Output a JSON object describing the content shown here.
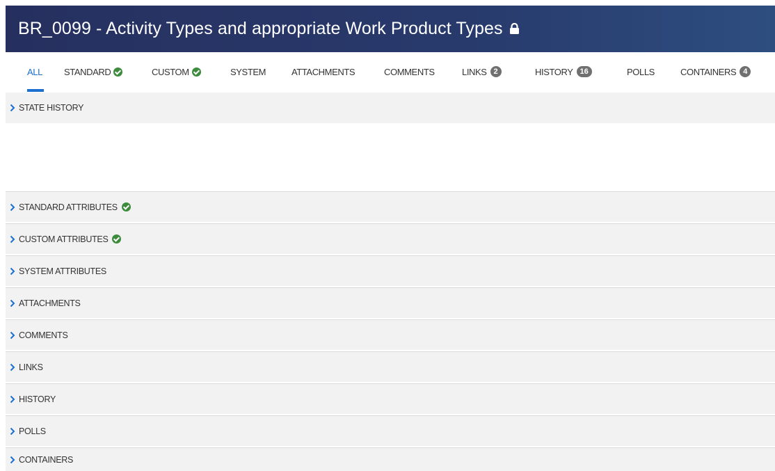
{
  "header": {
    "title": "BR_0099 - Activity Types and appropriate Work Product Types",
    "lock_icon": "lock-icon",
    "background": "#26305f"
  },
  "tabs": [
    {
      "label": "ALL",
      "active": true
    },
    {
      "label": "STANDARD",
      "icon": "check-circle-icon"
    },
    {
      "label": "CUSTOM",
      "icon": "check-circle-icon"
    },
    {
      "label": "SYSTEM"
    },
    {
      "label": "ATTACHMENTS"
    },
    {
      "label": "COMMENTS"
    },
    {
      "label": "LINKS",
      "count": "2"
    },
    {
      "label": "HISTORY",
      "count": "16"
    },
    {
      "label": "POLLS"
    },
    {
      "label": "CONTAINERS",
      "count": "4"
    }
  ],
  "sections": [
    {
      "label": "STATE HISTORY",
      "icon": "chevron-right-icon"
    },
    {
      "label": "STANDARD ATTRIBUTES",
      "icon": "chevron-right-icon",
      "status_icon": "check-circle-icon"
    },
    {
      "label": "CUSTOM ATTRIBUTES",
      "icon": "chevron-right-icon",
      "status_icon": "check-circle-icon"
    },
    {
      "label": "SYSTEM ATTRIBUTES",
      "icon": "chevron-right-icon"
    },
    {
      "label": "ATTACHMENTS",
      "icon": "chevron-right-icon"
    },
    {
      "label": "COMMENTS",
      "icon": "chevron-right-icon"
    },
    {
      "label": "LINKS",
      "icon": "chevron-right-icon"
    },
    {
      "label": "HISTORY",
      "icon": "chevron-right-icon"
    },
    {
      "label": "POLLS",
      "icon": "chevron-right-icon"
    },
    {
      "label": "CONTAINERS",
      "icon": "chevron-right-icon"
    }
  ],
  "colors": {
    "accent": "#1a6fd0",
    "check": "#3d8b3d",
    "badge": "#707070",
    "section_bg": "#f2f2f2"
  }
}
